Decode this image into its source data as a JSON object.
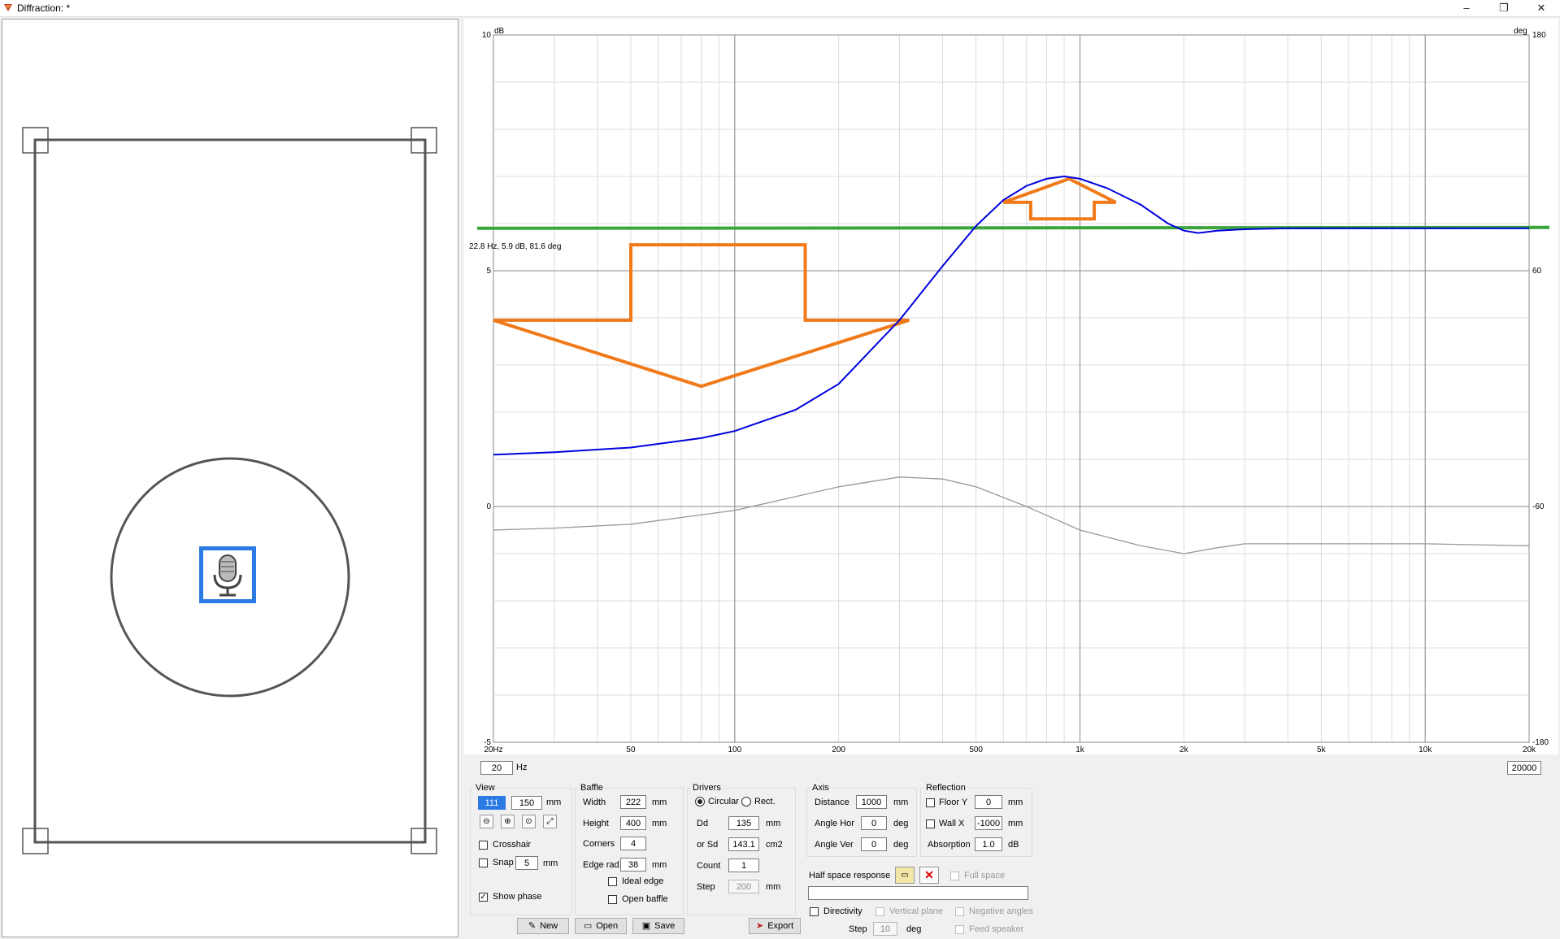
{
  "window": {
    "title": "Diffraction: *",
    "minimize": "–",
    "restore": "❐",
    "close": "✕"
  },
  "chart_data": {
    "type": "line",
    "x_scale": "log",
    "xlim": [
      20,
      20000
    ],
    "ylim": [
      -5,
      10
    ],
    "y2lim": [
      -180,
      180
    ],
    "ylabel": "dB",
    "y2label": "deg",
    "x_tick_labels": [
      "20Hz",
      "50",
      "100",
      "200",
      "500",
      "1k",
      "2k",
      "5k",
      "10k",
      "20k"
    ],
    "x_tick_values": [
      20,
      50,
      100,
      200,
      500,
      1000,
      2000,
      5000,
      10000,
      20000
    ],
    "y_tick_labels": [
      "10",
      "5",
      "0",
      "-5"
    ],
    "y_tick_values": [
      10,
      5,
      0,
      -5
    ],
    "y2_tick_labels": [
      "180",
      "60",
      "-60",
      "-180"
    ],
    "y2_tick_values": [
      180,
      60,
      -60,
      -180
    ],
    "readout": "22.8 Hz, 5.9 dB, 81.6 deg",
    "grid": true,
    "series": [
      {
        "color": "#0000dd",
        "x": [
          20,
          30,
          50,
          80,
          100,
          150,
          200,
          300,
          400,
          500,
          600,
          700,
          800,
          900,
          1000,
          1200,
          1500,
          1800,
          2000,
          2200,
          2500,
          3000,
          4000,
          5000,
          10000,
          20000
        ],
        "y": [
          1.1,
          1.15,
          1.25,
          1.45,
          1.6,
          2.05,
          2.6,
          3.95,
          5.1,
          5.95,
          6.5,
          6.8,
          6.95,
          7.0,
          6.95,
          6.75,
          6.4,
          6.0,
          5.85,
          5.8,
          5.85,
          5.88,
          5.9,
          5.9,
          5.9,
          5.9
        ]
      },
      {
        "color": "#999999",
        "unit": "deg",
        "x": [
          20,
          30,
          50,
          100,
          200,
          300,
          400,
          500,
          700,
          1000,
          1500,
          2000,
          2500,
          3000,
          5000,
          10000,
          20000
        ],
        "y": [
          -72,
          -71,
          -69,
          -62,
          -50,
          -45,
          -46,
          -50,
          -60,
          -72,
          -80,
          -84,
          -81,
          -79,
          -79,
          -79,
          -80
        ]
      }
    ],
    "annotations": {
      "green_line_db": 5.9,
      "orange_down_arrow": true,
      "orange_up_arrow": true
    }
  },
  "freq_range": {
    "min": "20",
    "min_unit": "Hz",
    "max": "20000"
  },
  "view": {
    "title": "View",
    "x": "111",
    "y": "150",
    "unit": "mm",
    "crosshair": "Crosshair",
    "snap": "Snap",
    "snap_value": "5",
    "snap_unit": "mm",
    "show_phase": "Show phase",
    "show_phase_checked": true,
    "crosshair_checked": false,
    "snap_checked": false
  },
  "baffle": {
    "title": "Baffle",
    "width_label": "Width",
    "width": "222",
    "height_label": "Height",
    "height": "400",
    "corners_label": "Corners",
    "corners": "4",
    "edge_label": "Edge rad.",
    "edge": "38",
    "unit": "mm",
    "ideal_edge": "Ideal edge",
    "open_baffle": "Open baffle"
  },
  "drivers": {
    "title": "Drivers",
    "circular": "Circular",
    "rect": "Rect.",
    "dd_label": "Dd",
    "dd": "135",
    "dd_unit": "mm",
    "sd_label": "or Sd",
    "sd": "143.1",
    "sd_unit": "cm2",
    "count_label": "Count",
    "count": "1",
    "step_label": "Step",
    "step": "200",
    "step_unit": "mm"
  },
  "axis": {
    "title": "Axis",
    "distance_label": "Distance",
    "distance": "1000",
    "distance_unit": "mm",
    "angle_hor_label": "Angle Hor",
    "angle_hor": "0",
    "angle_ver_label": "Angle Ver",
    "angle_ver": "0",
    "deg": "deg"
  },
  "reflection": {
    "title": "Reflection",
    "floor_label": "Floor Y",
    "floor": "0",
    "wall_label": "Wall  X",
    "wall": "-1000",
    "unit": "mm",
    "absorption_label": "Absorption",
    "absorption": "1.0",
    "absorption_unit": "dB"
  },
  "half_space": {
    "label": "Half space response",
    "full_space": "Full space",
    "path": ""
  },
  "directivity": {
    "label": "Directivity",
    "vertical_plane": "Vertical plane",
    "negative_angles": "Negative angles",
    "step_label": "Step",
    "step": "10",
    "step_unit": "deg",
    "feed_speaker": "Feed speaker"
  },
  "buttons": {
    "new": "New",
    "open": "Open",
    "save": "Save",
    "export": "Export"
  },
  "icons": [
    "app-icon",
    "microphone-icon",
    "zoom-out-icon",
    "zoom-in-icon",
    "zoom-fit-icon",
    "expand-icon",
    "folder-open-icon",
    "delete-icon",
    "new-icon",
    "save-icon",
    "export-icon"
  ]
}
